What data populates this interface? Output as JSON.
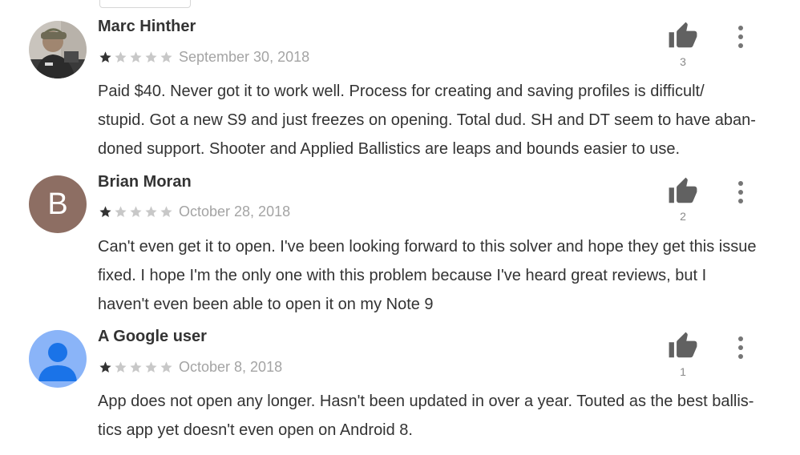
{
  "reviews": [
    {
      "author": "Marc Hinther",
      "avatar": "photo-avatar",
      "rating": 1,
      "max_rating": 5,
      "date": "September 30, 2018",
      "helpful_count": "3",
      "lines": [
        "Paid $40. Never got it to work well. Process for creating and saving profiles is difficult/",
        "stupid. Got a new S9 and just freezes on opening. Total dud. SH and DT seem to have aban-",
        "doned support. Shooter and Applied Ballistics are leaps and bounds easier to use."
      ]
    },
    {
      "author": "Brian Moran",
      "avatar_letter": "B",
      "avatar_color": "#8d6e63",
      "rating": 1,
      "max_rating": 5,
      "date": "October 28, 2018",
      "helpful_count": "2",
      "lines": [
        "Can't even get it to open. I've been looking forward to this solver and hope they get this issue",
        "fixed. I hope I'm the only one with this problem because I've heard great reviews, but I",
        "haven't even been able to open it on my Note 9"
      ]
    },
    {
      "author": "A Google user",
      "avatar": "default-user-avatar",
      "avatar_color": "#8ab4f8",
      "rating": 1,
      "max_rating": 5,
      "date": "October 8, 2018",
      "helpful_count": "1",
      "lines": [
        "App does not open any longer. Hasn't been updated in over a year. Touted as the best ballis-",
        "tics app yet doesn't even open on Android 8."
      ]
    }
  ],
  "icons": {
    "helpful": "thumb-up-icon",
    "more": "more-vert-icon",
    "star_filled": "star-filled-icon",
    "star_empty": "star-empty-icon"
  },
  "colors": {
    "star_filled": "#333333",
    "star_empty": "#c8c8c8",
    "thumb": "#616161",
    "date": "#a4a4a4"
  }
}
